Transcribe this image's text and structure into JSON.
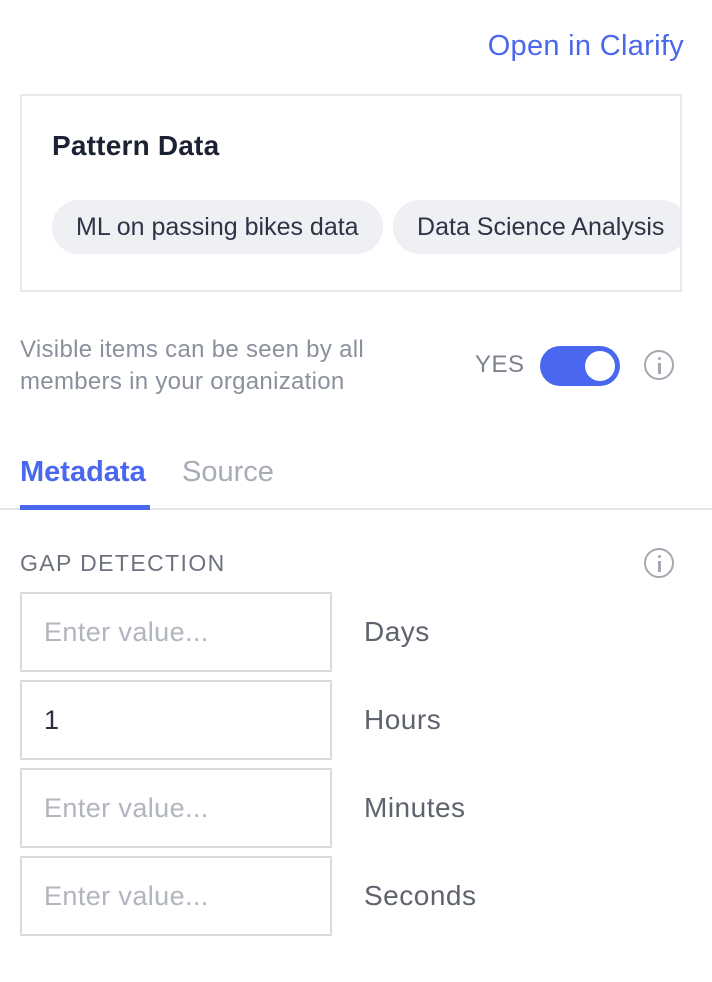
{
  "header": {
    "open_link": "Open in Clarify"
  },
  "card": {
    "title": "Pattern Data",
    "chips": [
      "ML on passing bikes data",
      "Data Science Analysis"
    ]
  },
  "visibility": {
    "description": "Visible items can be seen by all members in your organization",
    "state_label": "YES",
    "enabled": true,
    "accent_color": "#4a67f0"
  },
  "tabs": [
    {
      "label": "Metadata",
      "active": true
    },
    {
      "label": "Source",
      "active": false
    }
  ],
  "gap_detection": {
    "label": "GAP DETECTION",
    "fields": [
      {
        "unit": "Days",
        "value": "",
        "placeholder": "Enter value..."
      },
      {
        "unit": "Hours",
        "value": "1",
        "placeholder": "Enter value..."
      },
      {
        "unit": "Minutes",
        "value": "",
        "placeholder": "Enter value..."
      },
      {
        "unit": "Seconds",
        "value": "",
        "placeholder": "Enter value..."
      }
    ]
  },
  "icons": {
    "info": "info-circle-icon"
  }
}
